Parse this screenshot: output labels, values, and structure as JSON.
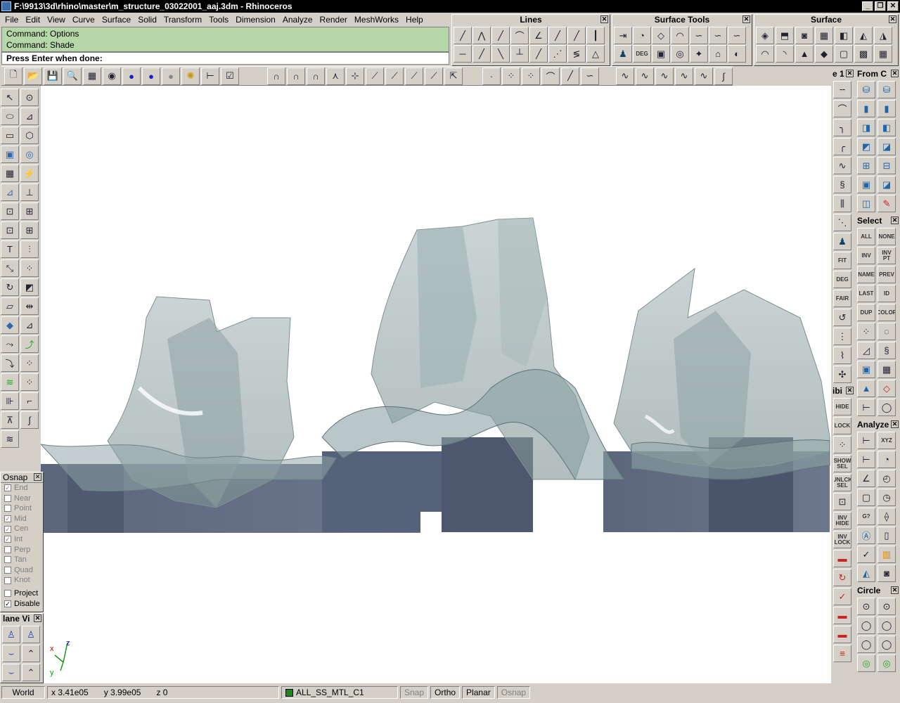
{
  "window": {
    "title": "F:\\9913\\3d\\rhino\\master\\m_structure_03022001_aaj.3dm - Rhinoceros"
  },
  "menu": [
    "File",
    "Edit",
    "View",
    "Curve",
    "Surface",
    "Solid",
    "Transform",
    "Tools",
    "Dimension",
    "Analyze",
    "Render",
    "MeshWorks",
    "Help"
  ],
  "command": {
    "line1": "Command: Options",
    "line2": "Command: Shade",
    "prompt": "Press Enter when done:"
  },
  "panels": {
    "lines": "Lines",
    "surface_tools": "Surface Tools",
    "surface": "Surface",
    "from": "From C",
    "select": "Select",
    "analyze": "Analyze",
    "circle": "Circle",
    "e1": "e 1",
    "ibi": "ibi",
    "plane": "lane Vi"
  },
  "select_buttons": [
    "ALL",
    "NONE",
    "INV",
    "INV PT",
    "NAME",
    "PREV",
    "LAST",
    "ID",
    "DUP",
    "COLOR"
  ],
  "visibility_buttons": [
    "HIDE",
    "LOCK",
    "SHOW SEL",
    "UNLCK SEL",
    "INV HIDE",
    "INV LOCK"
  ],
  "curve_tools": [
    "FIT",
    "DEG",
    "FAIR"
  ],
  "osnap": {
    "title": "Osnap",
    "items": [
      {
        "label": "End",
        "checked": true,
        "disabled": true
      },
      {
        "label": "Near",
        "checked": false,
        "disabled": true
      },
      {
        "label": "Point",
        "checked": false,
        "disabled": true
      },
      {
        "label": "Mid",
        "checked": true,
        "disabled": true
      },
      {
        "label": "Cen",
        "checked": true,
        "disabled": true
      },
      {
        "label": "Int",
        "checked": true,
        "disabled": true
      },
      {
        "label": "Perp",
        "checked": false,
        "disabled": true
      },
      {
        "label": "Tan",
        "checked": false,
        "disabled": true
      },
      {
        "label": "Quad",
        "checked": false,
        "disabled": true
      },
      {
        "label": "Knot",
        "checked": false,
        "disabled": true
      },
      {
        "label": "Project",
        "checked": false,
        "disabled": false
      },
      {
        "label": "Disable",
        "checked": true,
        "disabled": false
      }
    ]
  },
  "status": {
    "cplane": "World",
    "x": "x 3.41e05",
    "y": "y 3.99e05",
    "z": "z 0",
    "layer": "ALL_SS_MTL_C1",
    "snap": "Snap",
    "ortho": "Ortho",
    "planar": "Planar",
    "osnap": "Osnap"
  },
  "axis": {
    "z": "z",
    "x": "x",
    "y": "y"
  },
  "colors": {
    "command_bg": "#b6d7a8",
    "title_bg": "#000000",
    "layer_swatch": "#1a8a1a",
    "building": "#5e6a80",
    "glass": "#9fb4b4"
  }
}
